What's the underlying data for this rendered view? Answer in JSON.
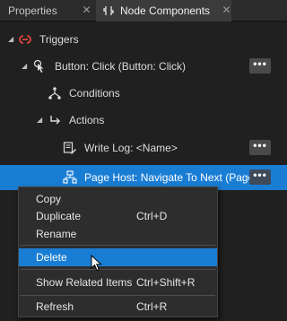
{
  "tabs": [
    {
      "label": "Properties",
      "active": false
    },
    {
      "label": "Node Components",
      "active": true
    }
  ],
  "tab_close_glyph": "✕",
  "tree": {
    "triggers_label": "Triggers",
    "button_click_label": "Button: Click (Button: Click)",
    "conditions_label": "Conditions",
    "actions_label": "Actions",
    "write_log_label": "Write Log: <Name>",
    "page_host_label": "Page Host: Navigate To Next (Page",
    "more_label": "•••"
  },
  "context_menu": {
    "items": [
      {
        "label": "Copy",
        "shortcut": ""
      },
      {
        "label": "Duplicate",
        "shortcut": "Ctrl+D"
      },
      {
        "label": "Rename",
        "shortcut": ""
      },
      {
        "label": "Delete",
        "shortcut": ""
      },
      {
        "label": "Show Related Items",
        "shortcut": "Ctrl+Shift+R"
      },
      {
        "label": "Refresh",
        "shortcut": "Ctrl+R"
      }
    ],
    "hovered_item": "Delete"
  },
  "colors": {
    "selection": "#1a7dd4",
    "trigger_icon": "#e0473a",
    "background": "#202020"
  },
  "icons": {
    "triggers": "trigger-icon",
    "button_click": "button-click-icon",
    "conditions": "conditions-icon",
    "actions": "actions-icon",
    "write_log": "write-log-icon",
    "page_host": "page-host-icon"
  }
}
